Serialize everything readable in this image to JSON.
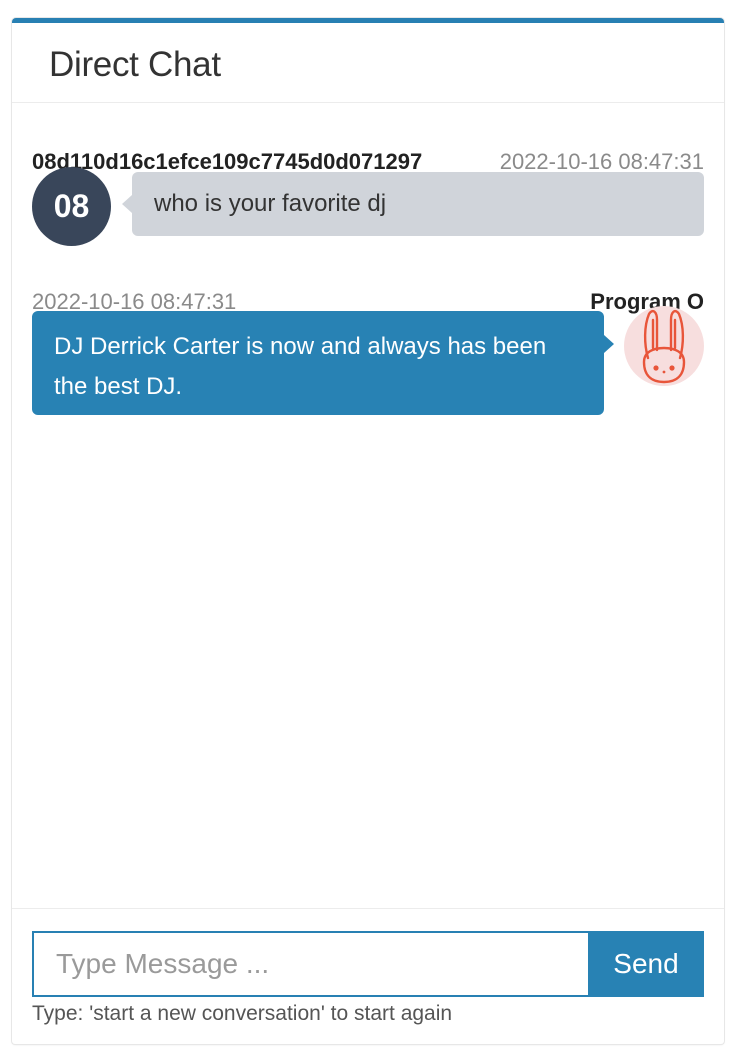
{
  "card": {
    "title": "Direct Chat",
    "accent_color": "#2880b3"
  },
  "messages": [
    {
      "side": "left",
      "name": "08d110d16c1efce109c7745d0d071297",
      "time": "2022-10-16 08:47:31",
      "avatar_text": "08",
      "text": "who is your favorite dj"
    },
    {
      "side": "right",
      "name": "Program O",
      "time": "2022-10-16 08:47:31",
      "avatar_icon": "rabbit-icon",
      "text": "DJ Derrick Carter is now and always has been the best DJ."
    }
  ],
  "composer": {
    "placeholder": "Type Message ...",
    "value": "",
    "send_label": "Send",
    "hint": "Type: 'start a new conversation' to start again"
  }
}
